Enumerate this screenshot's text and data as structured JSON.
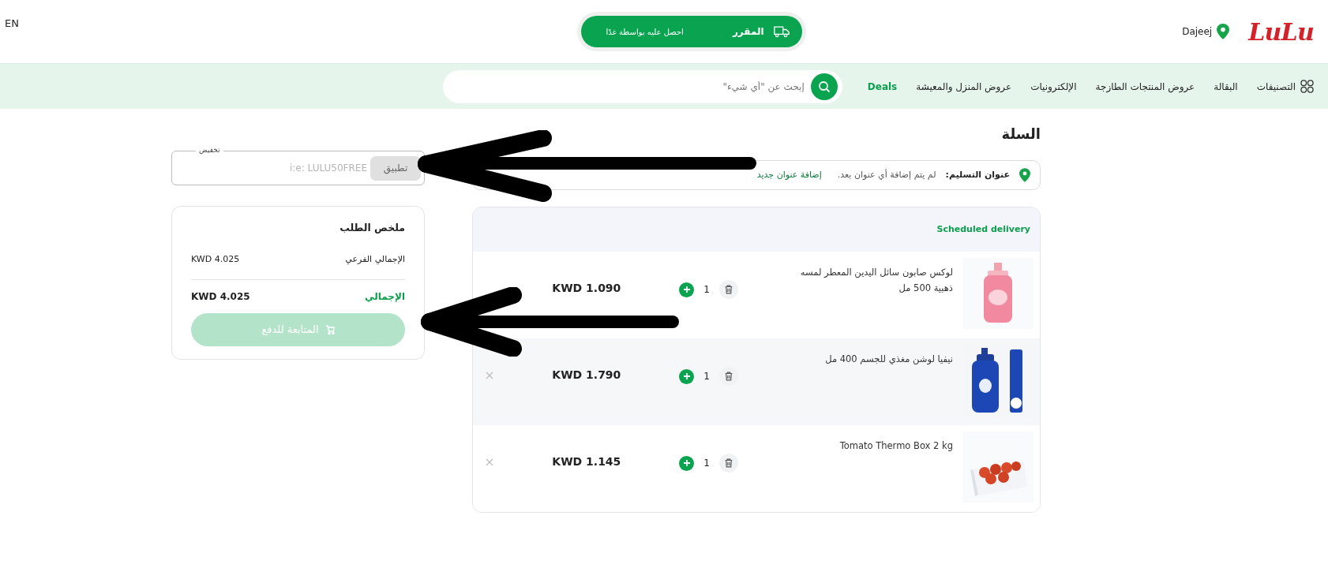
{
  "header": {
    "language": "EN",
    "delivery_pill": {
      "title": "المقرر",
      "subtitle": "احصل عليه بواسطة غدًا"
    },
    "location": "Dajeej",
    "logo": "LuLu"
  },
  "nav": {
    "categories_label": "التصنيفات",
    "items": [
      {
        "label": "البقالة",
        "highlighted": false
      },
      {
        "label": "عروض المنتجات الطازجة",
        "highlighted": false
      },
      {
        "label": "الإلكترونيات",
        "highlighted": false
      },
      {
        "label": "عروض المنزل والمعيشة",
        "highlighted": false
      },
      {
        "label": "Deals",
        "highlighted": true
      }
    ],
    "search_placeholder": "إبحث عن \"أي شيء\""
  },
  "cart": {
    "title": "السلة",
    "address": {
      "label": "عنوان التسليم:",
      "message": "لم يتم إضافة أي عنوان بعد.",
      "link": "إضافة عنوان جديد"
    },
    "section": "Scheduled delivery",
    "items": [
      {
        "name": "لوكس صابون سائل اليدين المعطر لمسه ذهبية 500 مل",
        "quantity": "1",
        "price": "KWD 1.090",
        "highlighted": false,
        "remove_visible": false
      },
      {
        "name": "نيفيا لوشن مغذي للجسم 400 مل",
        "quantity": "1",
        "price": "KWD 1.790",
        "highlighted": true,
        "remove_visible": true
      },
      {
        "name": "Tomato Thermo Box 2 kg",
        "quantity": "1",
        "price": "KWD 1.145",
        "highlighted": false,
        "remove_visible": true
      }
    ]
  },
  "coupon": {
    "label": "تخفيض",
    "placeholder": "i:e: LULU50FREE",
    "button": "تطبيق"
  },
  "summary": {
    "title": "ملخص الطلب",
    "subtotal_label": "الإجمالي الفرعي",
    "subtotal": "KWD 4.025",
    "total_label": "الإجمالي",
    "total": "KWD 4.025",
    "checkout": "المتابعة للدفع",
    "checkout_disabled": true
  }
}
